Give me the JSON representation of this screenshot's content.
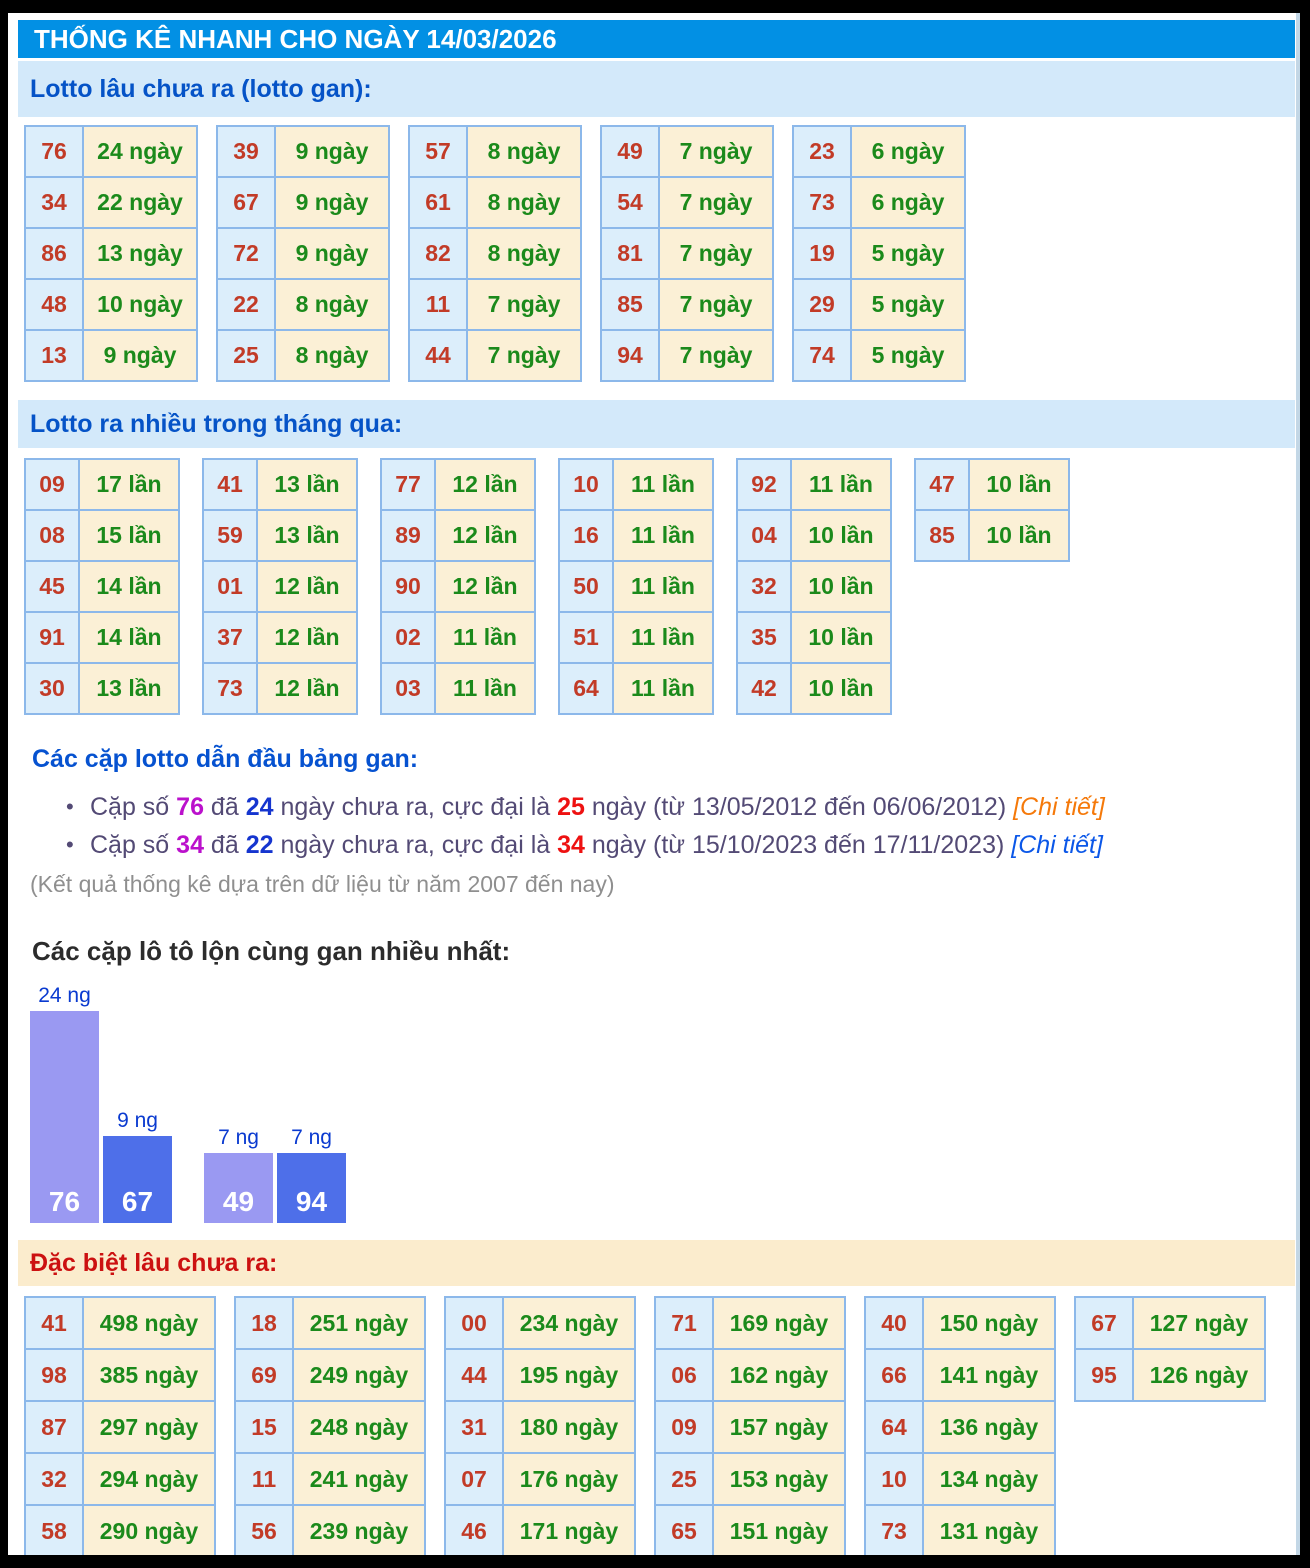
{
  "header": {
    "title": "THỐNG KÊ NHANH CHO NGÀY 14/03/2026"
  },
  "sections": {
    "lotto_gan": {
      "title": "Lotto lâu chưa ra (lotto gan):",
      "tables": [
        [
          [
            "76",
            "24 ngày"
          ],
          [
            "34",
            "22 ngày"
          ],
          [
            "86",
            "13 ngày"
          ],
          [
            "48",
            "10 ngày"
          ],
          [
            "13",
            "9 ngày"
          ]
        ],
        [
          [
            "39",
            "9 ngày"
          ],
          [
            "67",
            "9 ngày"
          ],
          [
            "72",
            "9 ngày"
          ],
          [
            "22",
            "8 ngày"
          ],
          [
            "25",
            "8 ngày"
          ]
        ],
        [
          [
            "57",
            "8 ngày"
          ],
          [
            "61",
            "8 ngày"
          ],
          [
            "82",
            "8 ngày"
          ],
          [
            "11",
            "7 ngày"
          ],
          [
            "44",
            "7 ngày"
          ]
        ],
        [
          [
            "49",
            "7 ngày"
          ],
          [
            "54",
            "7 ngày"
          ],
          [
            "81",
            "7 ngày"
          ],
          [
            "85",
            "7 ngày"
          ],
          [
            "94",
            "7 ngày"
          ]
        ],
        [
          [
            "23",
            "6 ngày"
          ],
          [
            "73",
            "6 ngày"
          ],
          [
            "19",
            "5 ngày"
          ],
          [
            "29",
            "5 ngày"
          ],
          [
            "74",
            "5 ngày"
          ]
        ]
      ]
    },
    "lotto_thang": {
      "title": "Lotto ra nhiều trong tháng qua:",
      "tables": [
        [
          [
            "09",
            "17 lần"
          ],
          [
            "08",
            "15 lần"
          ],
          [
            "45",
            "14 lần"
          ],
          [
            "91",
            "14 lần"
          ],
          [
            "30",
            "13 lần"
          ]
        ],
        [
          [
            "41",
            "13 lần"
          ],
          [
            "59",
            "13 lần"
          ],
          [
            "01",
            "12 lần"
          ],
          [
            "37",
            "12 lần"
          ],
          [
            "73",
            "12 lần"
          ]
        ],
        [
          [
            "77",
            "12 lần"
          ],
          [
            "89",
            "12 lần"
          ],
          [
            "90",
            "12 lần"
          ],
          [
            "02",
            "11 lần"
          ],
          [
            "03",
            "11 lần"
          ]
        ],
        [
          [
            "10",
            "11 lần"
          ],
          [
            "16",
            "11 lần"
          ],
          [
            "50",
            "11 lần"
          ],
          [
            "51",
            "11 lần"
          ],
          [
            "64",
            "11 lần"
          ]
        ],
        [
          [
            "92",
            "11 lần"
          ],
          [
            "04",
            "10 lần"
          ],
          [
            "32",
            "10 lần"
          ],
          [
            "35",
            "10 lần"
          ],
          [
            "42",
            "10 lần"
          ]
        ],
        [
          [
            "47",
            "10 lần"
          ],
          [
            "85",
            "10 lần"
          ]
        ]
      ]
    },
    "cap_gan": {
      "title": "Các cặp lotto dẫn đầu bảng gan:",
      "bullets": [
        {
          "segments": [
            {
              "text": "Cặp số ",
              "style": "normal"
            },
            {
              "text": "76",
              "style": "magenta"
            },
            {
              "text": " đã ",
              "style": "normal"
            },
            {
              "text": "24",
              "style": "blue"
            },
            {
              "text": " ngày chưa ra, cực đại là ",
              "style": "normal"
            },
            {
              "text": "25",
              "style": "red"
            },
            {
              "text": " ngày (từ 13/05/2012 đến 06/06/2012) ",
              "style": "normal"
            },
            {
              "text": "[Chi tiết]",
              "style": "link-orange"
            }
          ]
        },
        {
          "segments": [
            {
              "text": "Cặp số ",
              "style": "normal"
            },
            {
              "text": "34",
              "style": "magenta"
            },
            {
              "text": " đã ",
              "style": "normal"
            },
            {
              "text": "22",
              "style": "blue"
            },
            {
              "text": " ngày chưa ra, cực đại là ",
              "style": "normal"
            },
            {
              "text": "34",
              "style": "red"
            },
            {
              "text": " ngày (từ 15/10/2023 đến 17/11/2023) ",
              "style": "normal"
            },
            {
              "text": "[Chi tiết]",
              "style": "link-blue"
            }
          ]
        }
      ],
      "note": "(Kết quả thống kê dựa trên dữ liệu từ năm 2007 đến nay)"
    },
    "dac_biet": {
      "title": "Đặc biệt lâu chưa ra:",
      "tables": [
        [
          [
            "41",
            "498 ngày"
          ],
          [
            "98",
            "385 ngày"
          ],
          [
            "87",
            "297 ngày"
          ],
          [
            "32",
            "294 ngày"
          ],
          [
            "58",
            "290 ngày"
          ]
        ],
        [
          [
            "18",
            "251 ngày"
          ],
          [
            "69",
            "249 ngày"
          ],
          [
            "15",
            "248 ngày"
          ],
          [
            "11",
            "241 ngày"
          ],
          [
            "56",
            "239 ngày"
          ]
        ],
        [
          [
            "00",
            "234 ngày"
          ],
          [
            "44",
            "195 ngày"
          ],
          [
            "31",
            "180 ngày"
          ],
          [
            "07",
            "176 ngày"
          ],
          [
            "46",
            "171 ngày"
          ]
        ],
        [
          [
            "71",
            "169 ngày"
          ],
          [
            "06",
            "162 ngày"
          ],
          [
            "09",
            "157 ngày"
          ],
          [
            "25",
            "153 ngày"
          ],
          [
            "65",
            "151 ngày"
          ]
        ],
        [
          [
            "40",
            "150 ngày"
          ],
          [
            "66",
            "141 ngày"
          ],
          [
            "64",
            "136 ngày"
          ],
          [
            "10",
            "134 ngày"
          ],
          [
            "73",
            "131 ngày"
          ]
        ],
        [
          [
            "67",
            "127 ngày"
          ],
          [
            "95",
            "126 ngày"
          ]
        ]
      ]
    }
  },
  "chart_data": {
    "type": "bar",
    "title": "Các cặp lô tô lộn cùng gan nhiều nhất:",
    "categories": [
      "76",
      "67",
      "49",
      "94"
    ],
    "values": [
      24,
      9,
      7,
      7
    ],
    "unit": "ng",
    "bar_top_labels": [
      "24 ng",
      "9 ng",
      "7 ng",
      "7 ng"
    ],
    "pairs": [
      [
        "76",
        "67"
      ],
      [
        "49",
        "94"
      ]
    ],
    "bar_colors": [
      "#9a99f2",
      "#4e6fe9",
      "#9a99f2",
      "#4e6fe9"
    ],
    "ylim": [
      0,
      24
    ],
    "legend": "none",
    "grid": "off"
  },
  "colors": {
    "topbar_bg": "#0290e4",
    "band_bg": "#d3e9fa",
    "band_text": "#0553c7",
    "cream_band_bg": "#fbeccd",
    "cream_band_text": "#cc1111",
    "cell_border": "#8cb8ea",
    "number_text": "#c23b27",
    "value_text": "#1b8a1b"
  }
}
